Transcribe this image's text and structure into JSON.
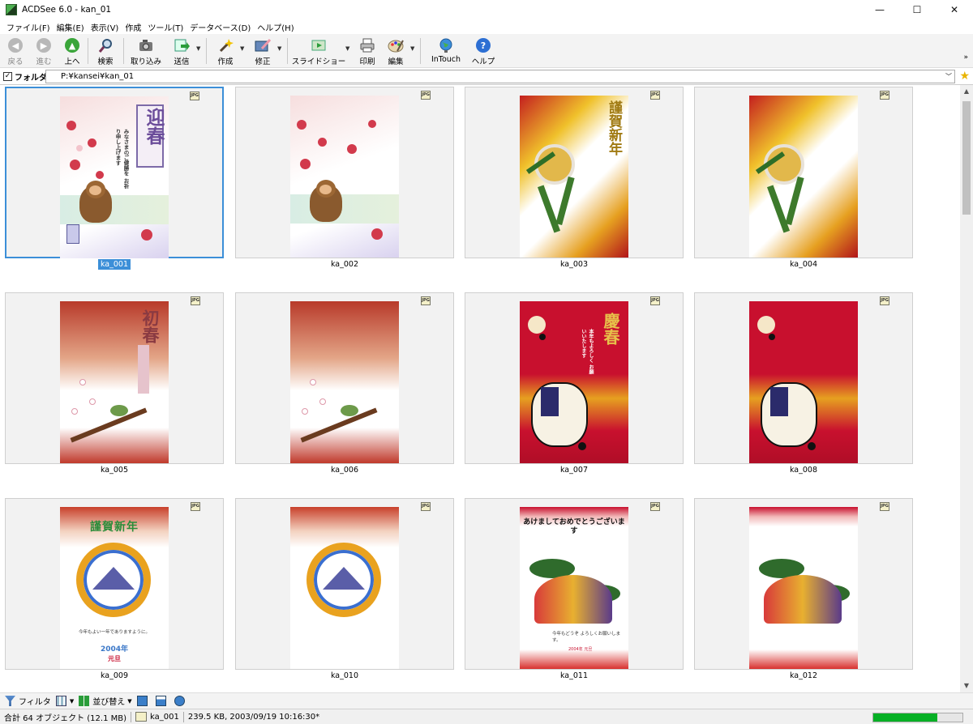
{
  "window": {
    "title": "ACDSee 6.0 - kan_01",
    "controls": [
      "—",
      "☐",
      "✕"
    ]
  },
  "menu": [
    "ファイル(F)",
    "編集(E)",
    "表示(V)",
    "作成",
    "ツール(T)",
    "データベース(D)",
    "ヘルプ(H)"
  ],
  "toolbar": {
    "back": "戻る",
    "forward": "進む",
    "up": "上へ",
    "search": "検索",
    "import": "取り込み",
    "send": "送信",
    "create": "作成",
    "edit_fix": "修正",
    "slideshow": "スライドショー",
    "print": "印刷",
    "edit": "編集",
    "intouch": "InTouch",
    "help": "ヘルプ"
  },
  "folder": {
    "checkbox": "✓",
    "label": "フォルダ:",
    "path": "P:¥kansei¥kan_01"
  },
  "thumbnails": [
    {
      "name": "ka_001",
      "badge": "JPG",
      "main": "迎春",
      "sub": "みなさまのご健勝を お祈り申し上げます",
      "selected": true
    },
    {
      "name": "ka_002",
      "badge": "JPG"
    },
    {
      "name": "ka_003",
      "badge": "JPG",
      "main": "謹賀新年"
    },
    {
      "name": "ka_004",
      "badge": "JPG"
    },
    {
      "name": "ka_005",
      "badge": "JPG",
      "main": "初春"
    },
    {
      "name": "ka_006",
      "badge": "JPG"
    },
    {
      "name": "ka_007",
      "badge": "JPG",
      "main": "慶春",
      "sub": "本年もよろしく お願いいたします"
    },
    {
      "name": "ka_008",
      "badge": "JPG"
    },
    {
      "name": "ka_009",
      "badge": "JPG",
      "main": "謹賀新年",
      "sub": "今年もよい一年でありますように。",
      "year": "2004年",
      "day": "元旦"
    },
    {
      "name": "ka_010",
      "badge": "JPG"
    },
    {
      "name": "ka_011",
      "badge": "JPG",
      "main": "あけましておめでとうございます",
      "sub": "今年もどうぞ よろしくお願いします。",
      "year": "2004年 元旦"
    },
    {
      "name": "ka_012",
      "badge": "JPG"
    }
  ],
  "viewbar": {
    "filter": "フィルタ",
    "sort": "並び替え"
  },
  "status": {
    "total": "合計 64 オブジェクト (12.1 MB)",
    "file": "ka_001",
    "details": "239.5 KB, 2003/09/19 10:16:30*",
    "progress": 0.72
  },
  "colors": {
    "accent": "#3c8fd8",
    "progress": "#06b025"
  }
}
